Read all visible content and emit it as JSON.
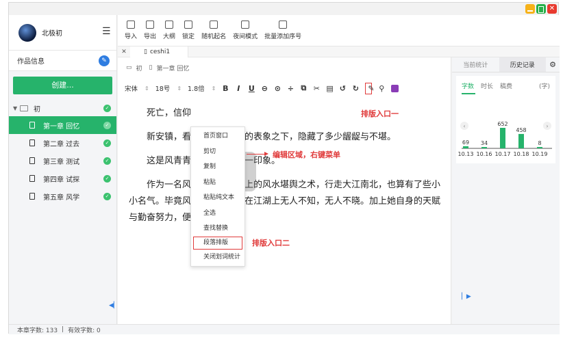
{
  "user": {
    "name": "北极初"
  },
  "sidebar": {
    "work_info_label": "作品信息",
    "create_label": "创建...",
    "root_label": "初",
    "chapters": [
      {
        "label": "第一章 回忆",
        "active": true
      },
      {
        "label": "第二章 过去"
      },
      {
        "label": "第三章 测试"
      },
      {
        "label": "第四章 试探"
      },
      {
        "label": "第五章 风学"
      }
    ]
  },
  "toolbar": {
    "items": [
      "导入",
      "导出",
      "大纲",
      "锁定",
      "随机起名",
      "夜间模式",
      "批量添加序号"
    ]
  },
  "tabs": {
    "open_tab": "ceshi1"
  },
  "breadcrumb": {
    "root": "初",
    "chapter": "第一章 回忆"
  },
  "format": {
    "font": "宋体",
    "size": "18号",
    "line_spacing": "1.8倍"
  },
  "editor": {
    "paragraphs": [
      "死亡，信仰",
      "新安镇，看起来平静如常的表象之下，隐藏了多少龌龊与不堪。",
      "这是风青青对新安镇的第一印象。",
      "作为一名风水师，凭借祖上的风水堪舆之术，行走大江南北，也算有了些小小名气。毕竟风水神算的名声在江湖上无人不知，无人不晓。加上她自身的天赋与勤奋努力，便成为了风如"
    ]
  },
  "context_menu": [
    "首页窗口",
    "剪切",
    "复制",
    "粘贴",
    "粘贴纯文本",
    "全选",
    "查找替换",
    "段落排版",
    "关闭划词统计"
  ],
  "annotations": {
    "entry_one": "排版入口一",
    "entry_two": "排版入口二",
    "edit_area": "编辑区域，右键菜单"
  },
  "right_panel": {
    "tabs": [
      "当前统计",
      "历史记录"
    ],
    "subtabs": [
      "字数",
      "时长",
      "稿费"
    ],
    "unit": "(字)"
  },
  "chart_data": {
    "type": "bar",
    "categories": [
      "10.13",
      "10.16",
      "10.17",
      "10.18",
      "10.19"
    ],
    "values": [
      69,
      34,
      652,
      458,
      8
    ],
    "color": "#26b36b"
  },
  "statusbar": {
    "chapter_words": "本章字数: 133",
    "separator": "|",
    "valid_words": "有效字数: 0"
  },
  "colors": {
    "accent": "#26b36b",
    "annotation": "#e03a3a",
    "badge": "#2f7de1"
  }
}
